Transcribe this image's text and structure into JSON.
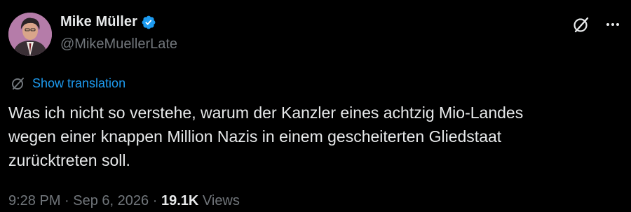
{
  "author": {
    "display_name": "Mike Müller",
    "handle": "@MikeMuellerLate",
    "verified": true,
    "verified_color": "#1d9bf0"
  },
  "header_icons": {
    "grok": "grok-icon",
    "more": "more-horizontal-icon"
  },
  "translation": {
    "icon": "grok-translate-icon",
    "label": "Show translation",
    "color": "#1d9bf0"
  },
  "tweet": {
    "lines": [
      "Was ich nicht so verstehe, warum der Kanzler eines achtzig Mio-Landes",
      "wegen einer knappen Million Nazis in einem gescheiterten Gliedstaat",
      "zurücktreten soll."
    ]
  },
  "meta": {
    "time": "9:28 PM",
    "separator": "·",
    "date": "Sep 6, 2026",
    "views_count": "19.1K",
    "views_label": "Views"
  },
  "colors": {
    "background": "#000000",
    "text_primary": "#e7e9ea",
    "text_secondary": "#71767b",
    "accent": "#1d9bf0"
  }
}
